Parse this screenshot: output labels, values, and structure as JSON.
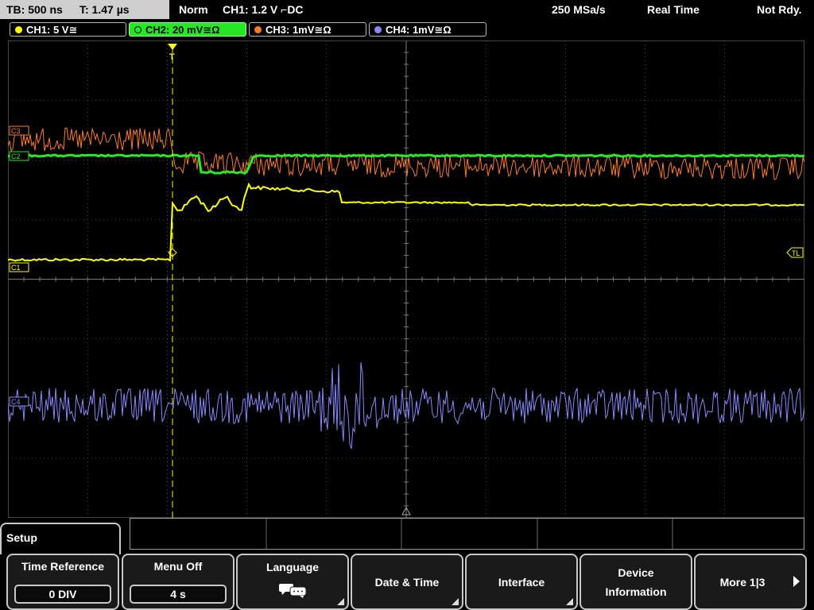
{
  "status": {
    "timebase": "TB: 500 ns",
    "trigger_time": "T: 1.47 µs",
    "trigger_mode": "Norm",
    "trigger_source": "CH1: 1.2 V ⌐DC",
    "sample_rate": "250 MSa/s",
    "acq_mode": "Real Time",
    "state": "Not Rdy."
  },
  "channels": [
    {
      "label": "CH1: 5 V≅",
      "color": "#ffff00",
      "marker": "C1"
    },
    {
      "label": "CH2: 20 mV≅Ω",
      "color": "#22ee22",
      "marker": "C2"
    },
    {
      "label": "CH3: 1mV≅Ω",
      "color": "#ff7a22",
      "marker": "C3"
    },
    {
      "label": "CH4: 1mV≅Ω",
      "color": "#8888ff",
      "marker": "C4"
    }
  ],
  "markers": {
    "trigger_level": "TL",
    "trigger_pos": "T"
  },
  "menu": {
    "title": "Setup",
    "softkeys": [
      {
        "title": "Time Reference",
        "value": "0 DIV"
      },
      {
        "title": "Menu Off",
        "value": "4 s"
      },
      {
        "title": "Language",
        "icon": "speech-bubble-icon"
      },
      {
        "title": "Date & Time"
      },
      {
        "title": "Interface"
      },
      {
        "title": "Device\nInformation",
        "title_line1": "Device",
        "title_line2": "Information"
      },
      {
        "title": "More 1|3",
        "label": "More 1|3"
      }
    ]
  },
  "colors": {
    "grid": "#7a7a7a",
    "screen_bg": "#000000",
    "ch1": "#ffff00",
    "ch2": "#22ee22",
    "ch3": "#ff7a22",
    "ch4": "#8888ff"
  }
}
